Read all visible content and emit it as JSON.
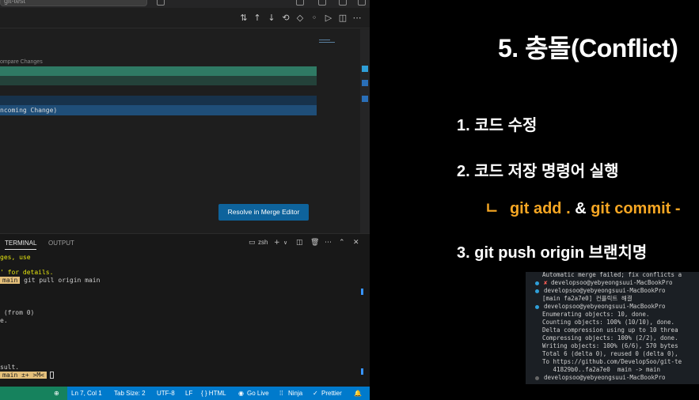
{
  "vscode": {
    "title_search": "git-test",
    "compare_label": "ompare Changes",
    "incoming_label": "ncoming Change)",
    "resolve_button": "Resolve in Merge Editor",
    "panel": {
      "tabs": [
        "TERMINAL",
        "OUTPUT"
      ],
      "shell_label": "zsh",
      "terminal_lines": [
        "ges, use",
        "' for details.",
        "main",
        " git pull origin main",
        " (from 0)",
        "e.",
        "sult.",
        "main ±+ >M<"
      ]
    },
    "statusbar": {
      "cursor": "Ln 7, Col 1",
      "tab_size": "Tab Size: 2",
      "encoding": "UTF-8",
      "eol": "LF",
      "language": "{ } HTML",
      "go_live": "Go Live",
      "ninja": "Ninja",
      "prettier": "Prettier"
    },
    "colors": {
      "current_change": "#2f7a64",
      "current_change_dim": "#24423a",
      "incoming_change": "#1f4e78",
      "incoming_change_dim": "#17324b",
      "accent": "#007acc"
    }
  },
  "slide": {
    "title": "5. 충돌(Conflict)",
    "step1": "1. 코드 수정",
    "step2": "2. 코드 저장 명령어 실행",
    "git_arrow": "ㄴ",
    "git_add": "git add .",
    "amp": "&",
    "git_commit": "git commit -",
    "step3": "3. git push origin 브랜치명",
    "terminal": {
      "lines": [
        "Automatic merge failed; fix conflicts a",
        "developsoo@yebyeongsuui-MacBookPro",
        "developsoo@yebyeongsuui-MacBookPro",
        "[main fa2a7e0] 컨플릭트 해결",
        "developsoo@yebyeongsuui-MacBookPro",
        "Enumerating objects: 10, done.",
        "Counting objects: 100% (10/10), done.",
        "Delta compression using up to 10 threa",
        "Compressing objects: 100% (2/2), done.",
        "Writing objects: 100% (6/6), 570 bytes",
        "Total 6 (delta 0), reused 0 (delta 0),",
        "To https://github.com/DevelopSoo/git-te",
        "   41829b0..fa2a7e0  main -> main",
        "developsoo@yebyeongsuui-MacBookPro"
      ]
    }
  }
}
